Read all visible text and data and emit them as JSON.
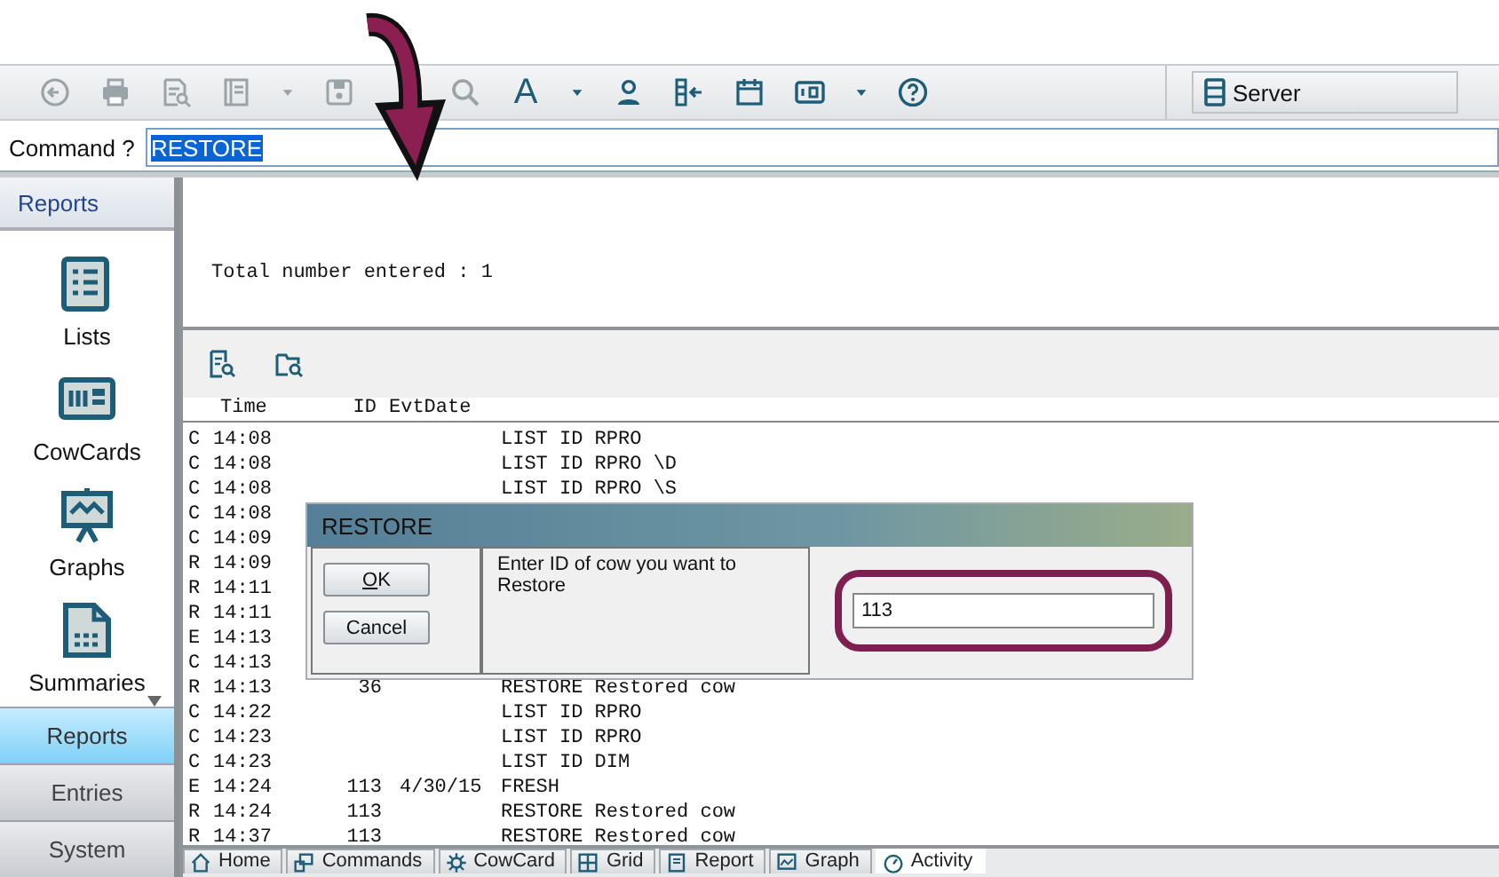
{
  "toolbar": {
    "items": [
      {
        "kind": "button",
        "disabled": true
      },
      {
        "kind": "button",
        "disabled": true
      },
      {
        "kind": "button",
        "disabled": true
      },
      {
        "kind": "button",
        "disabled": true
      },
      {
        "kind": "caret",
        "disabled": true
      },
      {
        "kind": "button",
        "disabled": true
      },
      {
        "kind": "button",
        "disabled": true
      },
      {
        "kind": "text",
        "label": "A",
        "disabled": false
      },
      {
        "kind": "caret",
        "disabled": false
      },
      {
        "kind": "button",
        "disabled": false
      },
      {
        "kind": "button",
        "disabled": false
      },
      {
        "kind": "button",
        "disabled": false
      },
      {
        "kind": "button",
        "disabled": false
      },
      {
        "kind": "caret",
        "disabled": false
      },
      {
        "kind": "button",
        "disabled": false
      }
    ],
    "server": {
      "label": "Server"
    }
  },
  "command": {
    "label": "Command ?",
    "value": "RESTORE",
    "value_selected": true
  },
  "sidebar": {
    "header": "Reports",
    "items": [
      {
        "label": "Lists",
        "menu": false
      },
      {
        "label": "CowCards",
        "menu": false
      },
      {
        "label": "Graphs",
        "menu": false
      },
      {
        "label": "Summaries",
        "menu": true
      }
    ]
  },
  "nav": [
    {
      "label": "Reports",
      "selected": true
    },
    {
      "label": "Entries",
      "selected": false
    },
    {
      "label": "System",
      "selected": false
    }
  ],
  "output": {
    "lines": [
      "Total number entered : 1"
    ]
  },
  "log": {
    "columns": [
      "Time",
      "ID",
      "EvtDate"
    ],
    "rows": [
      {
        "type": "C",
        "time": "14:08",
        "event": "LIST ID RPRO"
      },
      {
        "type": "C",
        "time": "14:08",
        "event": "LIST ID RPRO \\D"
      },
      {
        "type": "C",
        "time": "14:08",
        "event": "LIST ID RPRO \\S"
      },
      {
        "type": "C",
        "time": "14:08"
      },
      {
        "type": "C",
        "time": "14:09"
      },
      {
        "type": "R",
        "time": "14:09"
      },
      {
        "type": "R",
        "time": "14:11"
      },
      {
        "type": "R",
        "time": "14:11"
      },
      {
        "type": "E",
        "time": "14:13"
      },
      {
        "type": "C",
        "time": "14:13"
      },
      {
        "type": "R",
        "time": "14:13",
        "id": "36",
        "event": "RESTORE Restored cow"
      },
      {
        "type": "C",
        "time": "14:22",
        "event": "LIST ID RPRO"
      },
      {
        "type": "C",
        "time": "14:23",
        "event": "LIST ID RPRO"
      },
      {
        "type": "C",
        "time": "14:23",
        "event": "LIST ID DIM"
      },
      {
        "type": "E",
        "time": "14:24",
        "id": "113",
        "date": "4/30/15",
        "event": "FRESH"
      },
      {
        "type": "R",
        "time": "14:24",
        "id": "113",
        "event": "RESTORE Restored cow"
      },
      {
        "type": "R",
        "time": "14:37",
        "id": "113",
        "event": "RESTORE Restored cow"
      }
    ]
  },
  "dialog": {
    "title": "RESTORE",
    "buttons": [
      {
        "label": "OK",
        "mnemonic_underlined": true
      },
      {
        "label": "Cancel",
        "mnemonic_underlined": false
      }
    ],
    "message": "Enter ID of cow you want to Restore",
    "value": "113",
    "highlighted": true
  },
  "bottom_tabs": [
    {
      "label": "Home",
      "selected": false
    },
    {
      "label": "Commands",
      "selected": false
    },
    {
      "label": "CowCard",
      "selected": false
    },
    {
      "label": "Grid",
      "selected": false
    },
    {
      "label": "Report",
      "selected": false
    },
    {
      "label": "Graph",
      "selected": false
    },
    {
      "label": "Activity",
      "selected": true
    }
  ]
}
